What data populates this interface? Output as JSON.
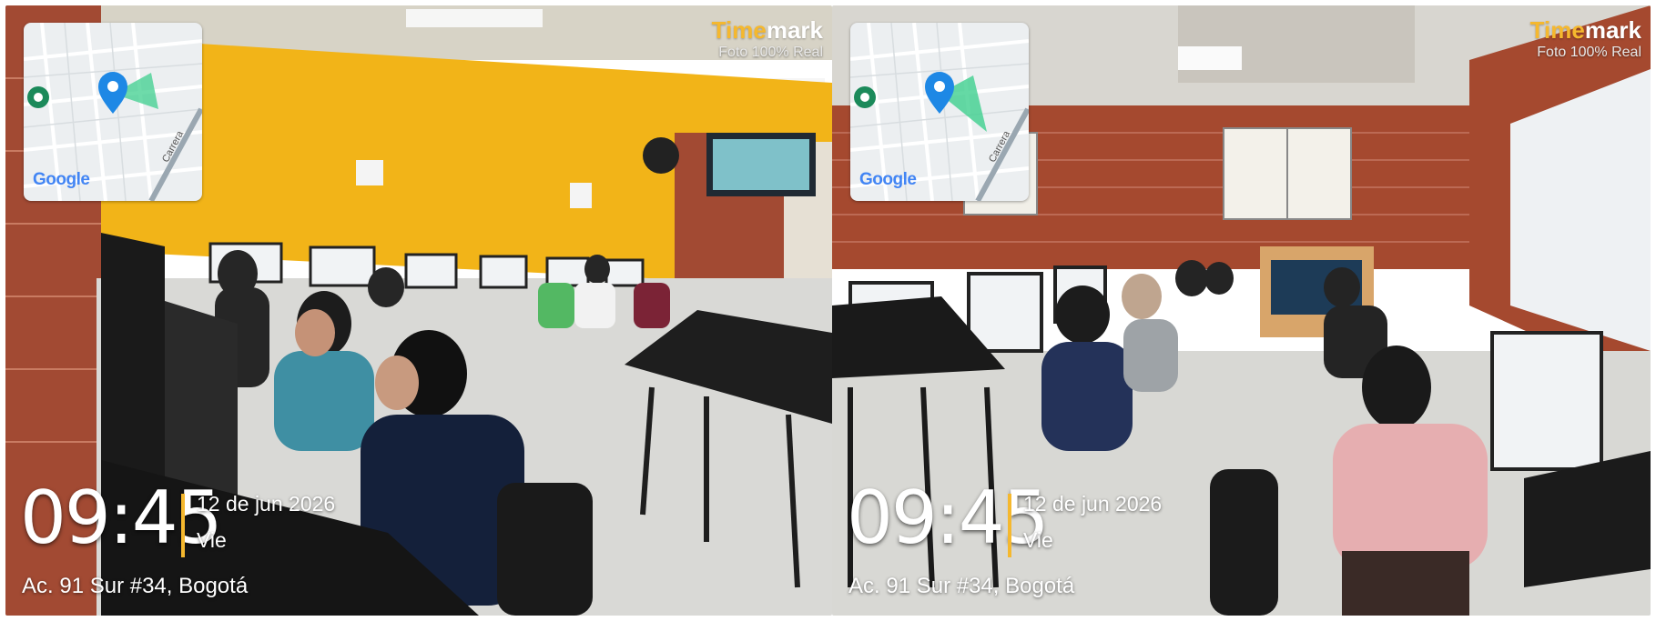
{
  "panels": [
    {
      "brand": {
        "part1": "Time",
        "part2": "mark",
        "subtitle": "Foto 100% Real"
      },
      "map": {
        "brand_text": "Google",
        "road_label": "Carrera"
      },
      "stamp": {
        "time": "09:45",
        "date": "12 de jun 2026",
        "weekday": "Vie",
        "address": "Ac. 91 Sur #34, Bogotá"
      }
    },
    {
      "brand": {
        "part1": "Time",
        "part2": "mark",
        "subtitle": "Foto 100% Real"
      },
      "map": {
        "brand_text": "Google",
        "road_label": "Carrera"
      },
      "stamp": {
        "time": "09:45",
        "date": "12 de jun 2026",
        "weekday": "Vie",
        "address": "Ac. 91 Sur #34, Bogotá"
      }
    }
  ],
  "colors": {
    "accent": "#f5b82e",
    "pin": "#1e88e5",
    "pin_alt": "#1b8a5a",
    "wall_yellow": "#f2b418",
    "brick": "#a24a33"
  },
  "icons": [
    "location-pin-icon",
    "direction-cone-icon",
    "map-marker-icon"
  ]
}
